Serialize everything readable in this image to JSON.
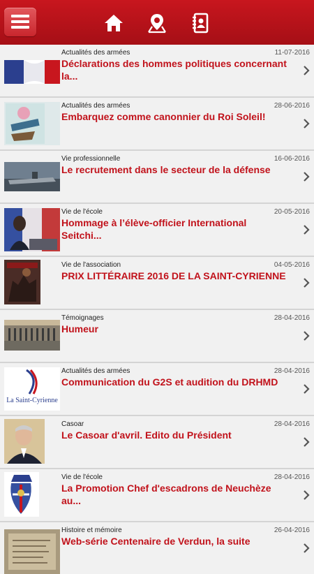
{
  "header": {
    "menu_icon": "hamburger-icon",
    "nav_icons": [
      "home-icon",
      "map-pin-icon",
      "contacts-icon"
    ],
    "colors": {
      "bar": "#b5121b",
      "title": "#c1121b"
    }
  },
  "articles": [
    {
      "category": "Actualités des armées",
      "date": "11-07-2016",
      "title": "Déclarations des hommes politiques concernant la..."
    },
    {
      "category": "Actualités des armées",
      "date": "28-06-2016",
      "title": "Embarquez comme canonnier du Roi Soleil!"
    },
    {
      "category": "Vie professionnelle",
      "date": "16-06-2016",
      "title": "Le recrutement dans le secteur de la défense"
    },
    {
      "category": "Vie de l'école",
      "date": "20-05-2016",
      "title": "Hommage à l’élève-officier International Seitchi..."
    },
    {
      "category": "Vie de l'association",
      "date": "04-05-2016",
      "title": "PRIX LITTÉRAIRE 2016 DE LA SAINT-CYRIENNE"
    },
    {
      "category": "Témoignages",
      "date": "28-04-2016",
      "title": "Humeur"
    },
    {
      "category": "Actualités des armées",
      "date": "28-04-2016",
      "title": "Communication du G2S et audition du DRHMD",
      "thumb_text": "La Saint-Cyrienne"
    },
    {
      "category": "Casoar",
      "date": "28-04-2016",
      "title": "Le Casoar d'avril. Edito du Président"
    },
    {
      "category": "Vie de l'école",
      "date": "28-04-2016",
      "title": "La Promotion Chef d'escadrons de Neuchèze au..."
    },
    {
      "category": "Histoire et mémoire",
      "date": "26-04-2016",
      "title": "Web-série Centenaire de Verdun, la suite"
    }
  ]
}
